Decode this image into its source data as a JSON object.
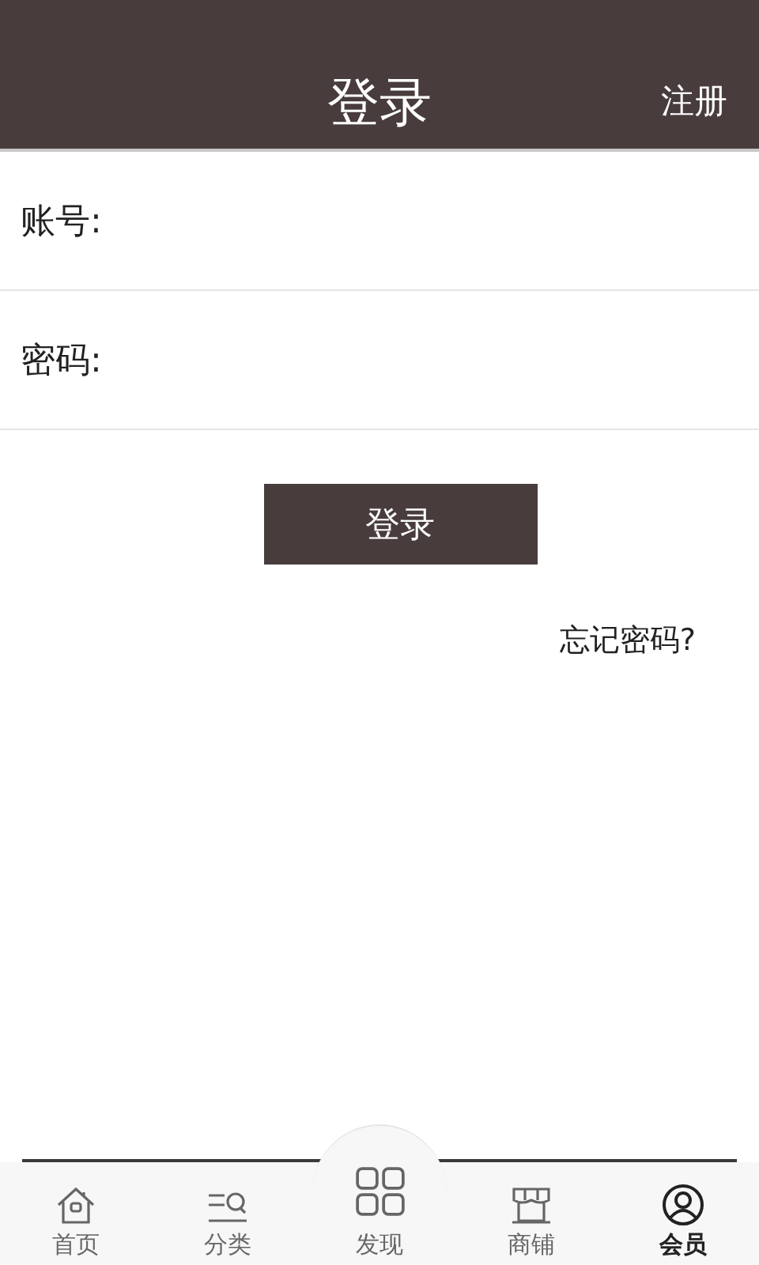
{
  "header": {
    "title": "登录",
    "action": "注册"
  },
  "fields": [
    {
      "label": "账号:"
    },
    {
      "label": "密码:"
    }
  ],
  "login_button": "登录",
  "forgot_link": "忘记密码?",
  "tabs": [
    {
      "label": "首页",
      "kind": "home",
      "selected": false
    },
    {
      "label": "分类",
      "kind": "category",
      "selected": false
    },
    {
      "label": "发现",
      "kind": "discover",
      "selected": false
    },
    {
      "label": "商铺",
      "kind": "shop",
      "selected": false
    },
    {
      "label": "会员",
      "kind": "member",
      "selected": true
    }
  ]
}
